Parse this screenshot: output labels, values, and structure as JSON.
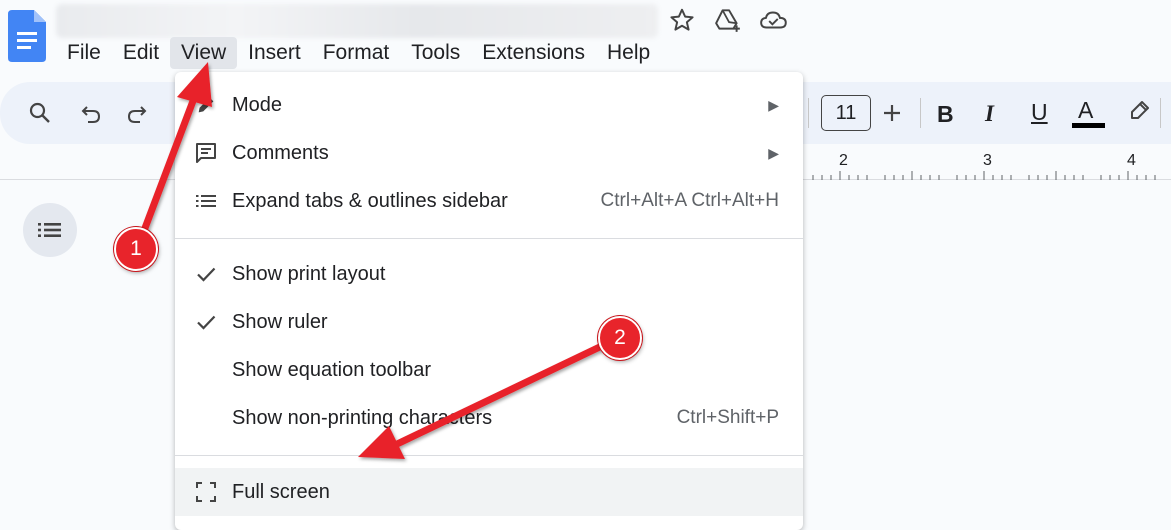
{
  "app": {
    "logo": "google-docs-icon",
    "title_icons": [
      "star-icon",
      "drive-add-icon",
      "cloud-saved-icon"
    ]
  },
  "menubar": {
    "items": [
      {
        "label": "File"
      },
      {
        "label": "Edit"
      },
      {
        "label": "View",
        "active": true
      },
      {
        "label": "Insert"
      },
      {
        "label": "Format"
      },
      {
        "label": "Tools"
      },
      {
        "label": "Extensions"
      },
      {
        "label": "Help"
      }
    ]
  },
  "toolbar": {
    "font_size": "11",
    "bold_label": "B",
    "italic_label": "I",
    "underline_label": "U",
    "text_color_label": "A",
    "text_color": "#000000",
    "icons": [
      "search-icon",
      "undo-icon",
      "redo-icon",
      "plus-icon",
      "highlight-pen-icon"
    ]
  },
  "ruler": {
    "labels": [
      "2",
      "3",
      "4"
    ]
  },
  "view_menu": {
    "items": [
      {
        "label": "Mode",
        "icon": "pencil-icon",
        "submenu": true
      },
      {
        "label": "Comments",
        "icon": "comment-icon",
        "submenu": true
      },
      {
        "label": "Expand tabs & outlines sidebar",
        "icon": "list-icon",
        "shortcut": "Ctrl+Alt+A Ctrl+Alt+H"
      },
      {
        "label": "Show print layout",
        "icon": "check-icon",
        "checked": true
      },
      {
        "label": "Show ruler",
        "icon": "check-icon",
        "checked": true
      },
      {
        "label": "Show equation toolbar"
      },
      {
        "label": "Show non-printing characters",
        "shortcut": "Ctrl+Shift+P"
      },
      {
        "label": "Full screen",
        "icon": "fullscreen-icon",
        "highlighted": true
      }
    ]
  },
  "annotations": {
    "badge_1": "1",
    "badge_2": "2",
    "arrow_color": "#e8242b"
  }
}
